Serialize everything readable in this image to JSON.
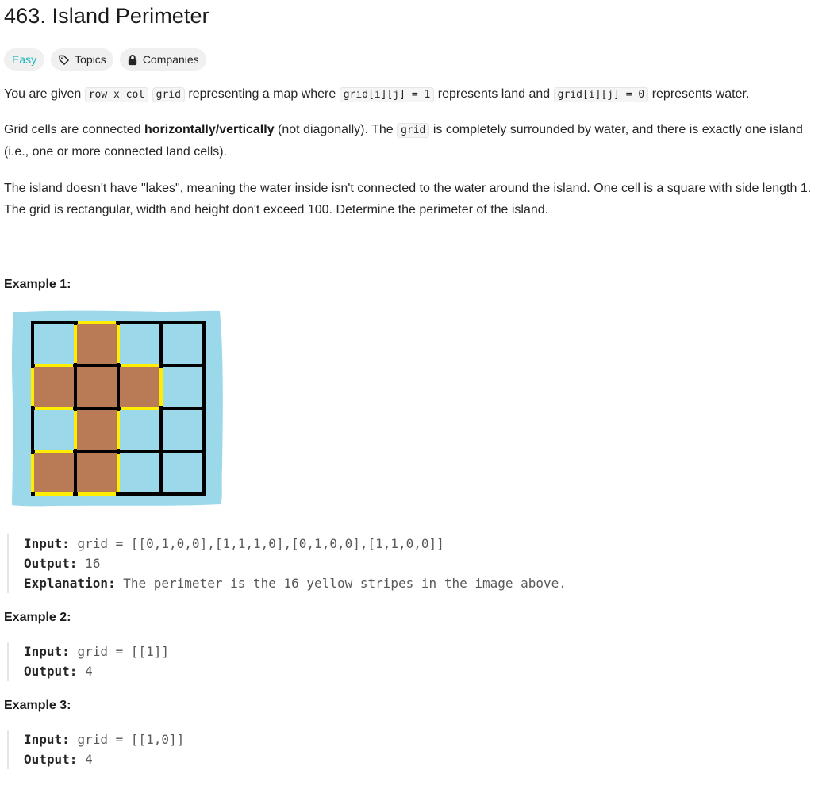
{
  "problem": {
    "title": "463. Island Perimeter"
  },
  "tags": {
    "difficulty": "Easy",
    "topics": "Topics",
    "companies": "Companies"
  },
  "description": {
    "p1_a": "You are given",
    "code_rowxcol": "row x col",
    "code_grid": "grid",
    "p1_b": "representing a map where",
    "code_land": "grid[i][j] = 1",
    "p1_c": "represents land and",
    "code_water": "grid[i][j] = 0",
    "p1_d": "represents water.",
    "p2_a": "Grid cells are connected",
    "p2_bold": "horizontally/vertically",
    "p2_b": "(not diagonally). The",
    "p2_code": "grid",
    "p2_c": "is completely surrounded by water, and there is exactly one island (i.e., one or more connected land cells).",
    "p3": "The island doesn't have \"lakes\", meaning the water inside isn't connected to the water around the island. One cell is a square with side length 1. The grid is rectangular, width and height don't exceed 100. Determine the perimeter of the island."
  },
  "examples": [
    {
      "title": "Example 1:",
      "input_label": "Input:",
      "input_value": "grid = [[0,1,0,0],[1,1,1,0],[0,1,0,0],[1,1,0,0]]",
      "output_label": "Output:",
      "output_value": "16",
      "explanation_label": "Explanation:",
      "explanation_value": "The perimeter is the 16 yellow stripes in the image above."
    },
    {
      "title": "Example 2:",
      "input_label": "Input:",
      "input_value": "grid = [[1]]",
      "output_label": "Output:",
      "output_value": "4"
    },
    {
      "title": "Example 3:",
      "input_label": "Input:",
      "input_value": "grid = [[1,0]]",
      "output_label": "Output:",
      "output_value": "4"
    }
  ],
  "figure": {
    "grid": [
      [
        0,
        1,
        0,
        0
      ],
      [
        1,
        1,
        1,
        0
      ],
      [
        0,
        1,
        0,
        0
      ],
      [
        1,
        1,
        0,
        0
      ]
    ],
    "water_color": "#9ad8ea",
    "land_color": "#b97a56",
    "line_color": "#000000",
    "perimeter_color": "#ffee00"
  }
}
